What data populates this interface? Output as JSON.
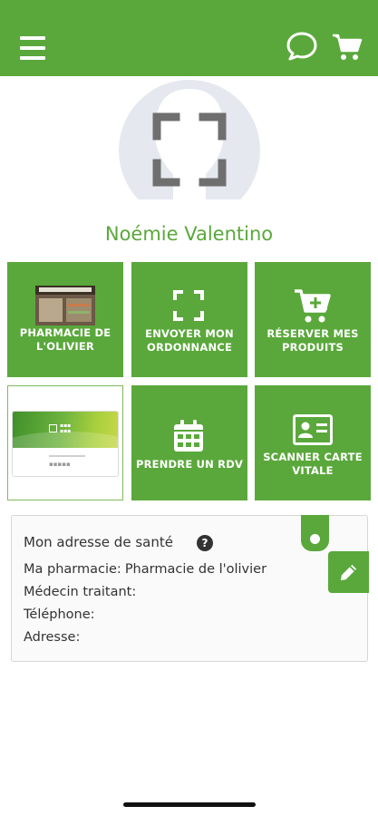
{
  "header": {
    "menu_icon": "hamburger-menu-icon",
    "chat_icon": "chat-bubble-icon",
    "cart_icon": "shopping-cart-icon",
    "accent_color": "#5aa83b"
  },
  "profile": {
    "avatar_icon": "scan-frame-icon",
    "name": "Noémie Valentino"
  },
  "tiles": [
    {
      "label": "PHARMACIE DE L'OLIVIER",
      "icon": "pharmacy-photo"
    },
    {
      "label": "ENVOYER MON ORDONNANCE",
      "icon": "scan-frame-icon"
    },
    {
      "label": "RÉSERVER MES PRODUITS",
      "icon": "cart-plus-icon"
    },
    {
      "label": "",
      "icon": "loyalty-card-image"
    },
    {
      "label": "PRENDRE UN RDV",
      "icon": "calendar-icon"
    },
    {
      "label": "SCANNER CARTE VITALE",
      "icon": "id-card-icon"
    }
  ],
  "health_address": {
    "title": "Mon adresse de santé",
    "help_icon": "question-circle-icon",
    "help_glyph": "?",
    "pharmacy_label": "Ma pharmacie:",
    "pharmacy_value": "Pharmacie de l'olivier",
    "doctor_label": "Médecin traitant:",
    "phone_label": "Téléphone:",
    "address_label": "Adresse:",
    "edit_icon": "pencil-icon"
  }
}
